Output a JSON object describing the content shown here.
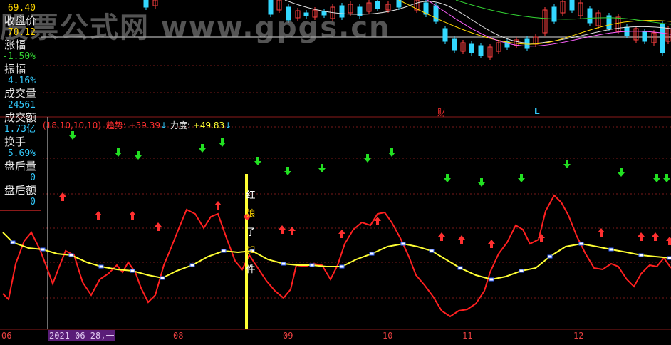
{
  "watermark": "股票公式网 www.gpgs.cn",
  "sidebar": {
    "top_value": "69.40",
    "items": [
      {
        "label": "收盘价",
        "value": "70.12",
        "color": "#ffd700"
      },
      {
        "label": "涨幅",
        "value": "-1.50%",
        "color": "#33d433"
      },
      {
        "label": "振幅",
        "value": "4.16%",
        "color": "#33ccff"
      },
      {
        "label": "成交量",
        "value": "24561",
        "color": "#33ccff"
      },
      {
        "label": "成交额",
        "value": "1.73亿",
        "color": "#33ccff"
      },
      {
        "label": "换手",
        "value": "5.69%",
        "color": "#33ccff"
      },
      {
        "label": "盘后量",
        "value": "0",
        "color": "#33ccff"
      },
      {
        "label": "盘后额",
        "value": "0",
        "color": "#33ccff"
      }
    ]
  },
  "price_panel": {
    "markers": [
      {
        "text": "财",
        "color": "#ff3030"
      },
      {
        "text": "L",
        "color": "#33ccff"
      }
    ]
  },
  "indicator": {
    "params": "(18,10,10,10)",
    "trend_label": "趋势:",
    "trend_value": "+39.39",
    "trend_arrow": "↓",
    "force_label": "力度:",
    "force_value": "+49.83",
    "force_arrow": "↓",
    "trend_color": "#ff3030",
    "force_color": "#ffff33",
    "vertical_text": [
      "红",
      "娘",
      "子",
      "起",
      "件"
    ]
  },
  "xaxis": {
    "ticks": [
      "06",
      "08",
      "09",
      "10",
      "11",
      "12"
    ],
    "selected_date": "2021-06-28,一"
  }
}
